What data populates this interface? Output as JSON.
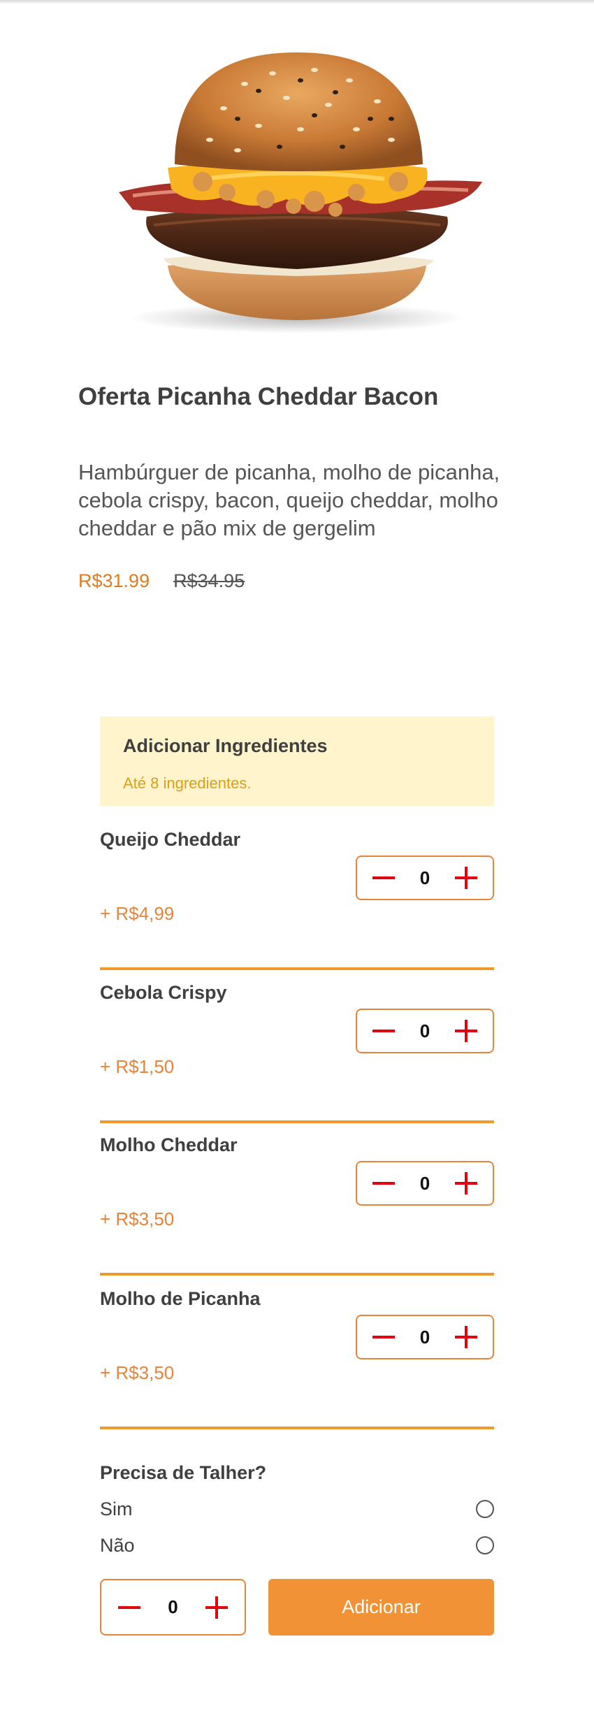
{
  "product": {
    "image_alt": "burger",
    "title": "Oferta Picanha Cheddar Bacon",
    "description": "Hambúrguer de picanha, molho de picanha, cebola crispy, bacon, queijo cheddar, molho cheddar e pão mix de gergelim",
    "price": "R$31.99",
    "old_price": "R$34.95"
  },
  "ingredients_section": {
    "title": "Adicionar Ingredientes",
    "subtitle": "Até 8 ingredientes."
  },
  "ingredients": [
    {
      "name": "Queijo Cheddar",
      "price": "+ R$4,99",
      "quantity": "0"
    },
    {
      "name": "Cebola Crispy",
      "price": "+ R$1,50",
      "quantity": "0"
    },
    {
      "name": "Molho Cheddar",
      "price": "+ R$3,50",
      "quantity": "0"
    },
    {
      "name": "Molho de Picanha",
      "price": "+ R$3,50",
      "quantity": "0"
    }
  ],
  "cutlery": {
    "title": "Precisa de Talher?",
    "options": [
      "Sim",
      "Não"
    ]
  },
  "order": {
    "quantity": "0",
    "add_label": "Adicionar"
  },
  "colors": {
    "accent": "#f09235",
    "price": "#e07b21",
    "stepper_icon": "#e3000f",
    "banner_bg": "#fff4cc",
    "banner_text": "#d9a01c"
  },
  "icons": {
    "minus": "minus-icon",
    "plus": "plus-icon"
  }
}
